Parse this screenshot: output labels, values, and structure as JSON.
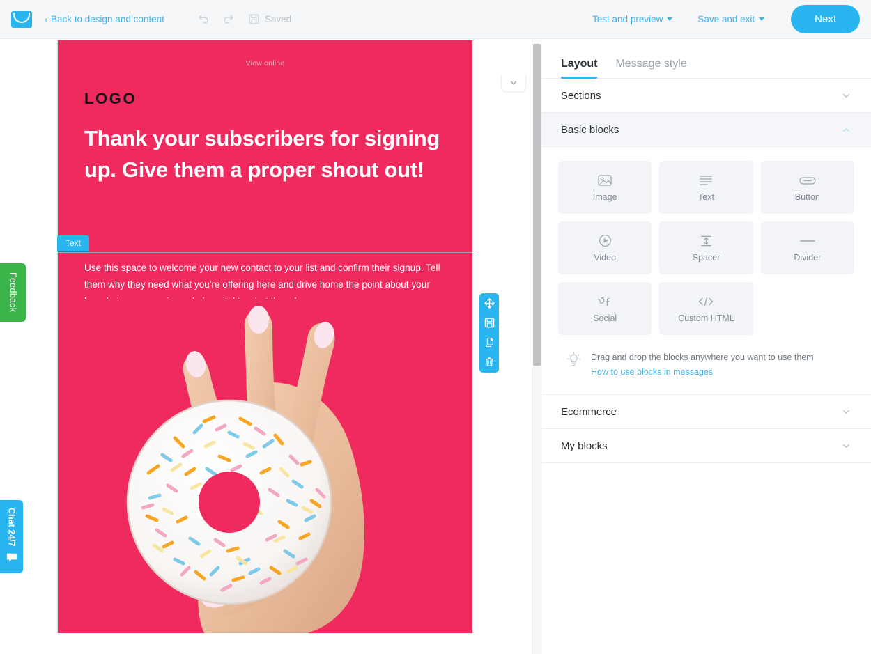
{
  "topbar": {
    "logo_icon": "envelope-logo-icon",
    "back_label": "Back to design and content",
    "back_chevron": "‹",
    "undo_icon": "undo-icon",
    "redo_icon": "redo-icon",
    "save_icon": "floppy-disk-icon",
    "saved_label": "Saved",
    "test_preview_label": "Test and preview",
    "save_exit_label": "Save and exit",
    "next_label": "Next",
    "accent_color": "#29b6f0",
    "link_color": "#3eb3ec"
  },
  "email": {
    "view_online": "View online",
    "logo_text": "LOGO",
    "headline": "Thank your subscribers for signing up. Give them a proper shout out!",
    "body_text": "Use this space to welcome your new contact to your list and confirm their signup. Tell them why they need what you're offering here and drive home the point about your knowledge or experience being vital to what they do.",
    "selected_block_badge": "Text",
    "background_color": "#ee2a5f",
    "hero_alt": "hand-holding-sprinkled-donut"
  },
  "block_tools": [
    {
      "name": "move-handle-icon",
      "title": "Move"
    },
    {
      "name": "save-block-icon",
      "title": "Save"
    },
    {
      "name": "duplicate-block-icon",
      "title": "Duplicate"
    },
    {
      "name": "delete-block-icon",
      "title": "Delete"
    }
  ],
  "canvas": {
    "collapse_icon": "chevron-down-icon",
    "scrollbar": "vertical-scrollbar"
  },
  "panel": {
    "tabs": [
      {
        "label": "Layout",
        "active": true
      },
      {
        "label": "Message style",
        "active": false
      }
    ],
    "sections": [
      {
        "label": "Sections",
        "open": false,
        "chevron": "chevron-down-icon"
      },
      {
        "label": "Basic blocks",
        "open": true,
        "chevron": "chevron-up-icon"
      },
      {
        "label": "Ecommerce",
        "open": false,
        "chevron": "chevron-down-icon"
      },
      {
        "label": "My blocks",
        "open": false,
        "chevron": "chevron-down-icon"
      }
    ],
    "basic_blocks": [
      {
        "label": "Image",
        "icon": "image-icon"
      },
      {
        "label": "Text",
        "icon": "text-lines-icon"
      },
      {
        "label": "Button",
        "icon": "button-pill-icon"
      },
      {
        "label": "Video",
        "icon": "video-play-icon"
      },
      {
        "label": "Spacer",
        "icon": "spacer-arrows-icon"
      },
      {
        "label": "Divider",
        "icon": "divider-line-icon"
      },
      {
        "label": "Social",
        "icon": "social-share-icon"
      },
      {
        "label": "Custom HTML",
        "icon": "code-brackets-icon"
      }
    ],
    "hint": {
      "icon": "lightbulb-icon",
      "text": "Drag and drop the blocks anywhere you want to use them",
      "link": "How to use blocks in messages"
    }
  },
  "edge_tabs": {
    "feedback_label": "Feedback",
    "feedback_color": "#3bb54a",
    "chat_label": "Chat 24/7",
    "chat_color": "#29b6f0",
    "chat_icon": "speech-bubble-icon"
  }
}
